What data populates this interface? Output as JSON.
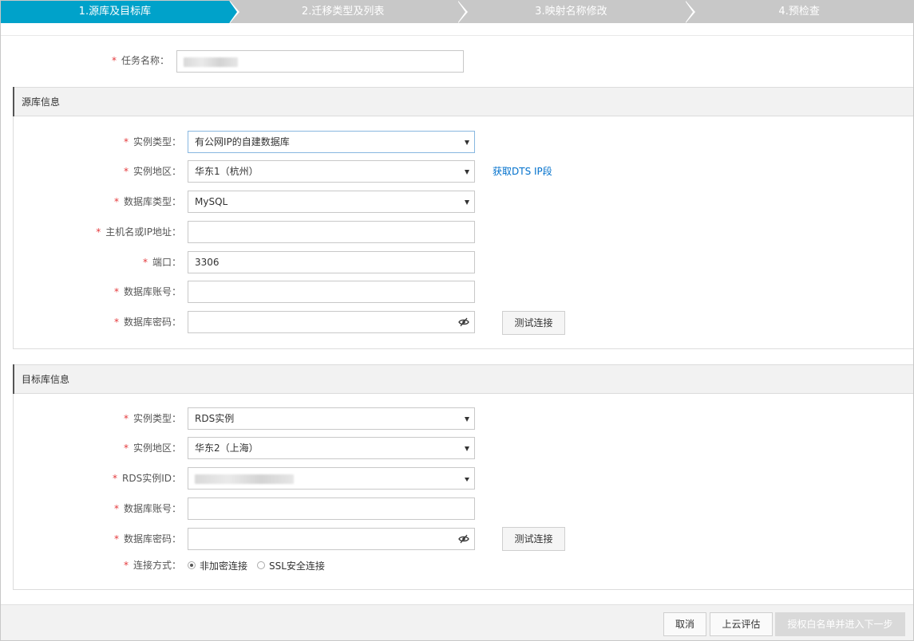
{
  "steps": [
    {
      "label": "1.源库及目标库",
      "active": true
    },
    {
      "label": "2.迁移类型及列表",
      "active": false
    },
    {
      "label": "3.映射名称修改",
      "active": false
    },
    {
      "label": "4.预检查",
      "active": false
    }
  ],
  "required_mark": "*",
  "task": {
    "label": "任务名称："
  },
  "source": {
    "title": "源库信息",
    "instance_type_label": "实例类型：",
    "instance_type_value": "有公网IP的自建数据库",
    "region_label": "实例地区：",
    "region_value": "华东1（杭州）",
    "get_ip_link": "获取DTS IP段",
    "db_type_label": "数据库类型：",
    "db_type_value": "MySQL",
    "host_label": "主机名或IP地址：",
    "host_value": "",
    "port_label": "端口：",
    "port_value": "3306",
    "account_label": "数据库账号：",
    "account_value": "",
    "password_label": "数据库密码：",
    "password_value": "",
    "test_button": "测试连接"
  },
  "target": {
    "title": "目标库信息",
    "instance_type_label": "实例类型：",
    "instance_type_value": "RDS实例",
    "region_label": "实例地区：",
    "region_value": "华东2（上海）",
    "rds_id_label": "RDS实例ID：",
    "account_label": "数据库账号：",
    "account_value": "",
    "password_label": "数据库密码：",
    "password_value": "",
    "test_button": "测试连接",
    "connection_label": "连接方式：",
    "connection_options": [
      "非加密连接",
      "SSL安全连接"
    ],
    "connection_selected": "非加密连接"
  },
  "footer": {
    "cancel": "取消",
    "evaluate": "上云评估",
    "next": "授权白名单并进入下一步"
  },
  "icons": {
    "eye": "eye-slash-icon",
    "caret": "chevron-down-icon"
  },
  "colors": {
    "active_step": "#00a2ca",
    "inactive_step": "#c8c8c8",
    "required": "#e4393c",
    "link": "#0070cc"
  }
}
